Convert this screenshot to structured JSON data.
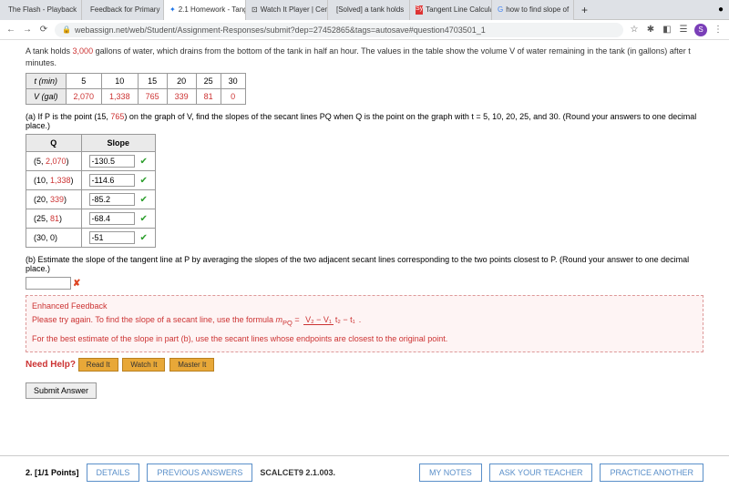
{
  "tabs": [
    {
      "title": "The Flash - Playback",
      "icon_color": "#e50914"
    },
    {
      "title": "Feedback for Primary",
      "icon_color": "#d97706"
    },
    {
      "title": "2.1 Homework - Tang",
      "icon_color": "#1a73e8",
      "active": true
    },
    {
      "title": "Watch It Player | Cen",
      "icon_color": "#1a73e8"
    },
    {
      "title": "[Solved] a tank holds",
      "icon_color": "#333"
    },
    {
      "title": "Tangent Line Calcula",
      "icon_color": "#d33"
    },
    {
      "title": "how to find slope of",
      "icon_color": "#4285f4"
    }
  ],
  "url": "webassign.net/web/Student/Assignment-Responses/submit?dep=27452865&tags=autosave#question4703501_1",
  "avatar_letter": "S",
  "problem": {
    "intro_pre": "A tank holds ",
    "intro_gallons": "3,000",
    "intro_post": " gallons of water, which drains from the bottom of the tank in half an hour. The values in the table show the volume V of water remaining in the tank (in gallons) after t minutes.",
    "t_header": "t (min)",
    "v_header": "V (gal)",
    "t_values": [
      "5",
      "10",
      "15",
      "20",
      "25",
      "30"
    ],
    "v_values": [
      "2,070",
      "1,338",
      "765",
      "339",
      "81",
      "0"
    ]
  },
  "part_a": {
    "label_pre": "(a)  If P is the point (15, ",
    "label_val": "765",
    "label_post": ") on the graph of V, find the slopes of the secant lines PQ when Q is the point on the graph with t = 5, 10, 20, 25, and 30. (Round your answers to one decimal place.)",
    "q_header": "Q",
    "slope_header": "Slope",
    "rows": [
      {
        "q_pre": "(5, ",
        "q_val": "2,070",
        "q_post": ")",
        "ans": "-130.5"
      },
      {
        "q_pre": "(10, ",
        "q_val": "1,338",
        "q_post": ")",
        "ans": "-114.6"
      },
      {
        "q_pre": "(20, ",
        "q_val": "339",
        "q_post": ")",
        "ans": "-85.2"
      },
      {
        "q_pre": "(25, ",
        "q_val": "81",
        "q_post": ")",
        "ans": "-68.4"
      },
      {
        "q_pre": "(30, 0)",
        "q_val": "",
        "q_post": "",
        "ans": "-51"
      }
    ]
  },
  "part_b": {
    "label": "(b)  Estimate the slope of the tangent line at P by averaging the slopes of the two adjacent secant lines corresponding to the two points closest to P. (Round your answer to one decimal place.)",
    "value": ""
  },
  "feedback": {
    "title": "Enhanced Feedback",
    "line1_pre": "Please try again. To find the slope of a secant line, use the formula ",
    "mpq": "m",
    "mpq_sub": "PQ",
    "eq": " = ",
    "frac_top": "V₂ − V₁",
    "frac_bot": "t₂ − t₁",
    "line1_post": ".",
    "line2": "For the best estimate of the slope in part (b), use the secant lines whose endpoints are closest to the original point."
  },
  "help": {
    "label": "Need Help?",
    "read": "Read It",
    "watch": "Watch It",
    "master": "Master It"
  },
  "submit_label": "Submit Answer",
  "bottom": {
    "qnum": "2.",
    "points": "[1/1 Points]",
    "details": "DETAILS",
    "prev": "PREVIOUS ANSWERS",
    "source": "SCALCET9 2.1.003.",
    "notes": "MY NOTES",
    "ask": "ASK YOUR TEACHER",
    "practice": "PRACTICE ANOTHER"
  }
}
